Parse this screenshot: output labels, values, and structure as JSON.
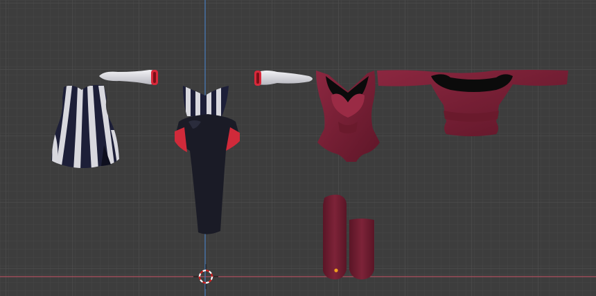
{
  "viewport": {
    "view": "3D Viewport",
    "background": "#3d3d3d",
    "grid_minor_color": "#474747",
    "grid_major_color": "#525252",
    "axis_x_color": "#b0505e",
    "axis_z_color": "#4a7fbf"
  },
  "objects": [
    {
      "id": "striped-dress",
      "colors": [
        "#1d1f38",
        "#d8d8de"
      ]
    },
    {
      "id": "sleeve-left",
      "colors": [
        "#d8d8de",
        "#d8283a"
      ]
    },
    {
      "id": "long-black-dress",
      "colors": [
        "#1a1b26",
        "#d02a3a",
        "#d8d8de"
      ]
    },
    {
      "id": "sleeve-right",
      "colors": [
        "#d8d8de",
        "#d8283a"
      ]
    },
    {
      "id": "maroon-bodysuit",
      "colors": [
        "#7a1f34",
        "#0b0b0b"
      ]
    },
    {
      "id": "maroon-off-shoulder-top",
      "colors": [
        "#7a1f34",
        "#0b0b0b"
      ]
    },
    {
      "id": "maroon-boot-left",
      "colors": [
        "#6e1d30"
      ]
    },
    {
      "id": "maroon-boot-right",
      "colors": [
        "#6e1d30"
      ]
    }
  ],
  "origin_dot_color": "#f0a020",
  "cursor": {
    "name": "3d-cursor",
    "colors": [
      "#d02020",
      "#ffffff"
    ]
  }
}
